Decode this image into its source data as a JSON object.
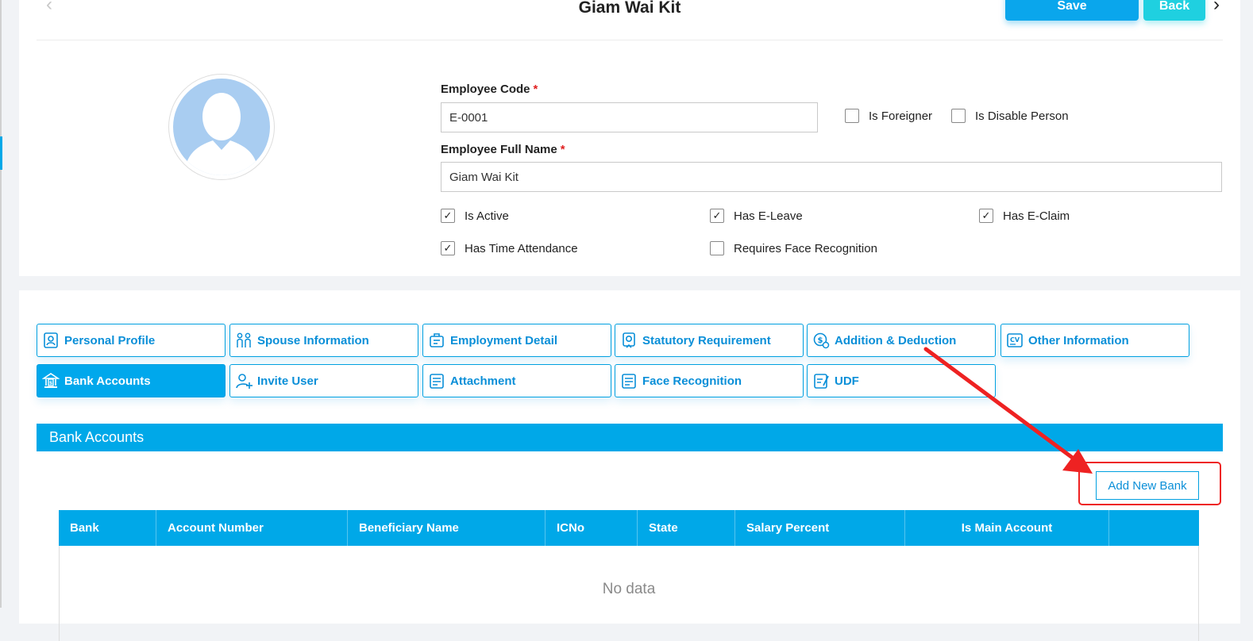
{
  "header": {
    "title": "Giam Wai Kit",
    "save_label": "Save",
    "back_label": "Back"
  },
  "form": {
    "employee_code_label": "Employee Code",
    "employee_code_value": "E-0001",
    "full_name_label": "Employee Full Name",
    "full_name_value": "Giam Wai Kit",
    "required_mark": "*",
    "checkboxes": [
      {
        "label": "Is Foreigner",
        "checked": false
      },
      {
        "label": "Is Disable Person",
        "checked": false
      },
      {
        "label": "Is Active",
        "checked": true
      },
      {
        "label": "Has E-Leave",
        "checked": true
      },
      {
        "label": "Has E-Claim",
        "checked": true
      },
      {
        "label": "Has Time Attendance",
        "checked": true
      },
      {
        "label": "Requires Face Recognition",
        "checked": false
      }
    ]
  },
  "tabs": [
    {
      "label": "Personal Profile",
      "icon": "profile-icon"
    },
    {
      "label": "Spouse Information",
      "icon": "couple-icon"
    },
    {
      "label": "Employment Detail",
      "icon": "briefcase-icon"
    },
    {
      "label": "Statutory Requirement",
      "icon": "certificate-icon"
    },
    {
      "label": "Addition & Deduction",
      "icon": "money-icon"
    },
    {
      "label": "Other Information",
      "icon": "cv-icon"
    },
    {
      "label": "Bank Accounts",
      "icon": "bank-icon",
      "active": true
    },
    {
      "label": "Invite User",
      "icon": "add-user-icon"
    },
    {
      "label": "Attachment",
      "icon": "document-icon"
    },
    {
      "label": "Face Recognition",
      "icon": "document-icon"
    },
    {
      "label": "UDF",
      "icon": "edit-document-icon"
    }
  ],
  "section": {
    "title": "Bank Accounts",
    "add_button": "Add New Bank"
  },
  "table": {
    "columns": [
      "Bank",
      "Account Number",
      "Beneficiary Name",
      "ICNo",
      "State",
      "Salary Percent",
      "Is Main Account",
      ""
    ],
    "empty_text": "No data"
  },
  "colors": {
    "accent": "#00a8e8",
    "annotation": "#ee2222"
  }
}
